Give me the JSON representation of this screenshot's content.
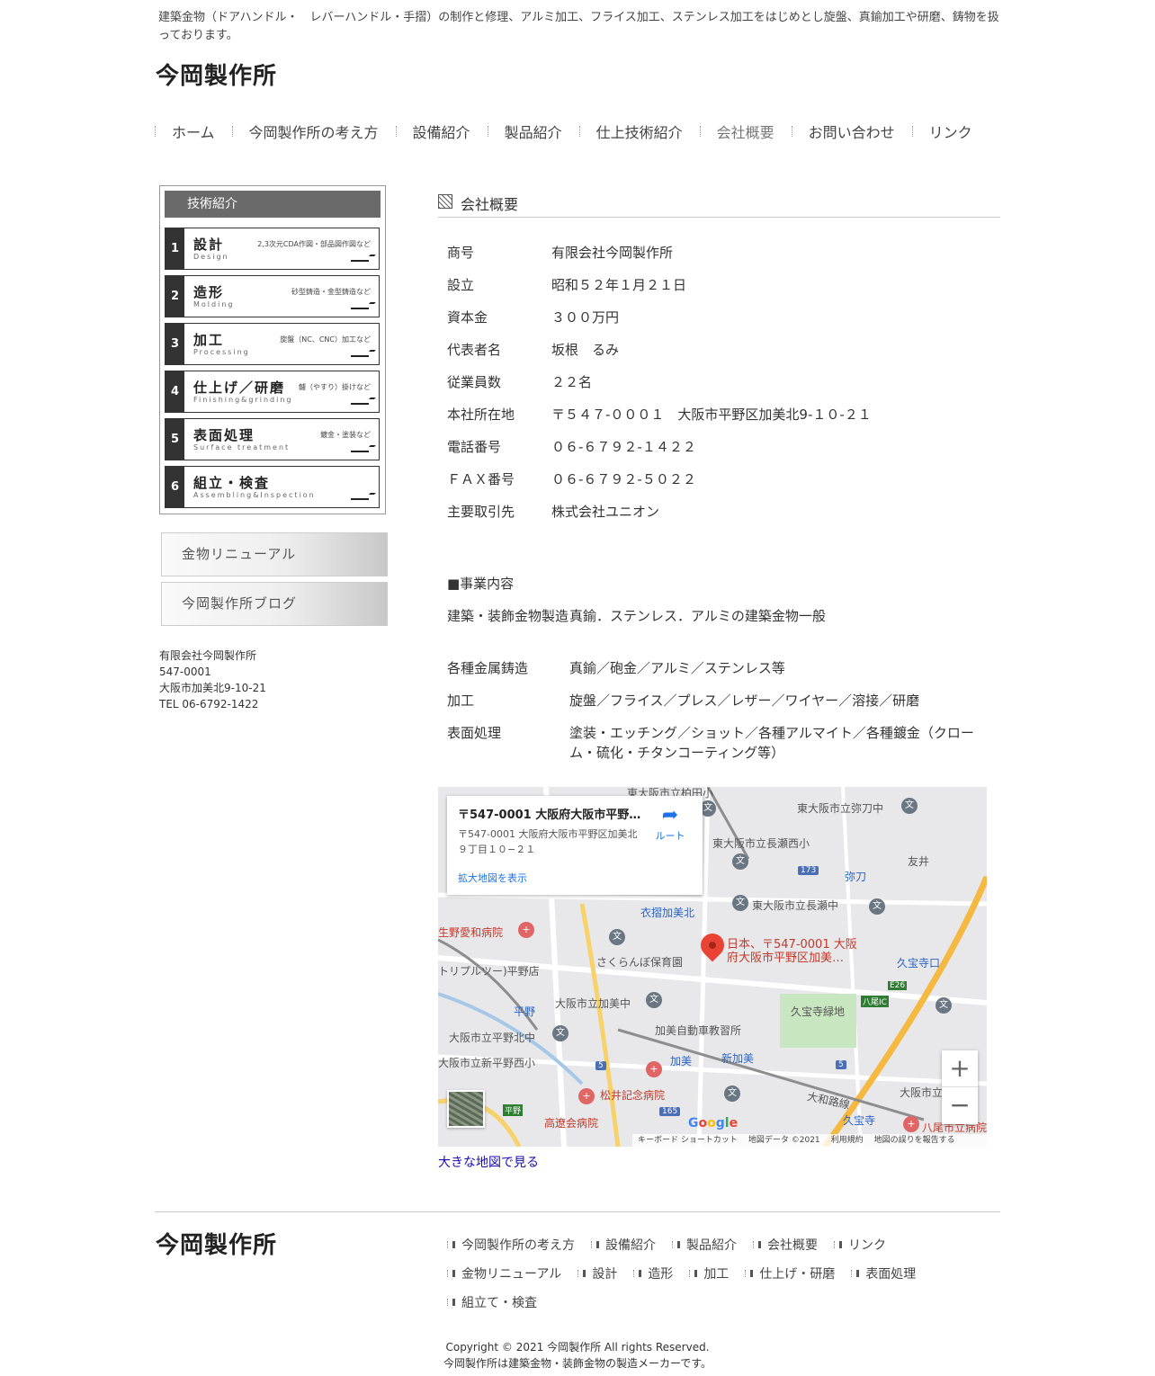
{
  "header": {
    "tagline": "建築金物（ドアハンドル・　レバーハンドル・手摺）の制作と修理、アルミ加工、フライス加工、ステンレス加工をはじめとし旋盤、真鍮加工や研磨、鋳物を扱っております。",
    "site_title": "今岡製作所"
  },
  "nav": {
    "items": [
      {
        "label": "ホーム"
      },
      {
        "label": "今岡製作所の考え方"
      },
      {
        "label": "設備紹介"
      },
      {
        "label": "製品紹介"
      },
      {
        "label": "仕上技術紹介"
      },
      {
        "label": "会社概要"
      },
      {
        "label": "お問い合わせ"
      },
      {
        "label": "リンク"
      }
    ]
  },
  "sidebar": {
    "tech_heading": "技術紹介",
    "tech_items": [
      {
        "num": "1",
        "title": "設計",
        "en": "Design",
        "note": "2,3次元CDA作図・部品図作図など"
      },
      {
        "num": "2",
        "title": "造形",
        "en": "Molding",
        "note": "砂型鋳造・金型鋳造など"
      },
      {
        "num": "3",
        "title": "加工",
        "en": "Processing",
        "note": "旋盤（NC、CNC）加工など"
      },
      {
        "num": "4",
        "title": "仕上げ／研磨",
        "en": "Finishing&grinding",
        "note": "鑢（やすり）掛けなど"
      },
      {
        "num": "5",
        "title": "表面処理",
        "en": "Surface treatment",
        "note": "鍍金・塗装など"
      },
      {
        "num": "6",
        "title": "組立・検査",
        "en": "Assembling&Inspection",
        "note": ""
      }
    ],
    "banners": [
      {
        "label": "金物リニューアル"
      },
      {
        "label": "今岡製作所ブログ"
      }
    ],
    "address": {
      "company": "有限会社今岡製作所",
      "zip": "547-0001",
      "addr": "大阪市加美北9-10-21",
      "tel": "TEL 06-6792-1422"
    }
  },
  "main": {
    "section_title": "会社概要",
    "profile": [
      {
        "k": "商号",
        "v": "有限会社今岡製作所"
      },
      {
        "k": "設立",
        "v": "昭和５２年１月２１日"
      },
      {
        "k": "資本金",
        "v": "３００万円"
      },
      {
        "k": "代表者名",
        "v": "坂根　るみ"
      },
      {
        "k": "従業員数",
        "v": "２２名"
      },
      {
        "k": "本社所在地",
        "v": "〒５４７-０００１　大阪市平野区加美北9-１０-２１"
      },
      {
        "k": "電話番号",
        "v": "０６-６７９２-１４２２"
      },
      {
        "k": "ＦＡＸ番号",
        "v": "０６-６７９２-５０２２"
      },
      {
        "k": "主要取引先",
        "v": "株式会社ユニオン"
      }
    ],
    "business_heading": "■事業内容",
    "business": [
      {
        "k": "建築・装飾金物製造",
        "v": "真鍮．ステンレス．アルミの建築金物一般"
      },
      {
        "k": "各種金属鋳造",
        "v": "真鍮／砲金／アルミ／ステンレス等"
      },
      {
        "k": "加工",
        "v": "旋盤／フライス／プレス／レザー／ワイヤー／溶接／研磨"
      },
      {
        "k": "表面処理",
        "v": "塗装・エッチング／ショット／各種アルマイト／各種鍍金（クローム・硫化・チタンコーティング等）"
      }
    ],
    "map": {
      "info_title": "〒547-0001 大阪府大阪市平野…",
      "info_address": "〒547-0001 大阪府大阪市平野区加美北９丁目１０−２１",
      "info_link": "拡大地図を表示",
      "route_label": "ルート",
      "marker_label": "日本、〒547-0001 大阪府大阪市平野区加美…",
      "labels": {
        "l1": "東大阪市立弥刀中",
        "l2": "東大阪市立柏田小",
        "l3": "東大阪市立長瀬西小",
        "l4": "弥刀",
        "l5": "友井",
        "l6": "東大阪市立長瀬中",
        "l7": "衣摺加美北",
        "l8": "生野愛和病院",
        "l9": "さくらんぼ保育園",
        "l10": "トリプルツー)平野店",
        "l11": "久宝寺口",
        "l12": "八尾IC",
        "l13": "久宝寺緑地",
        "l14": "大阪市立加美中",
        "l15": "平野",
        "l16": "加美自動車教習所",
        "l17": "大阪市立平野北中",
        "l18": "加美",
        "l19": "新加美",
        "l20": "大阪市立新平野西小",
        "l21": "松井記念病院",
        "l22": "大和路線",
        "l23": "大阪市立",
        "l24": "高遼会病院",
        "l25": "久宝寺",
        "l26": "八尾市立病院",
        "l27": "東大阪市立弥刀中"
      },
      "shields": {
        "s173": "173",
        "s26": "E26",
        "s5a": "5",
        "s5b": "5",
        "s165": "165",
        "sHirano": "平野"
      },
      "attribution": [
        "キーボード ショートカット",
        "地図データ ©2021",
        "利用規約",
        "地図の誤りを報告する"
      ],
      "google": "Google"
    },
    "map_link": "大きな地図で見る"
  },
  "footer": {
    "title": "今岡製作所",
    "links": [
      {
        "label": "今岡製作所の考え方"
      },
      {
        "label": "設備紹介"
      },
      {
        "label": "製品紹介"
      },
      {
        "label": "会社概要"
      },
      {
        "label": "リンク"
      },
      {
        "label": "金物リニューアル"
      },
      {
        "label": "設計"
      },
      {
        "label": "造形"
      },
      {
        "label": "加工"
      },
      {
        "label": "仕上げ・研磨"
      },
      {
        "label": "表面処理"
      },
      {
        "label": "組立て・検査"
      }
    ],
    "copyright": "Copyright © 2021 今岡製作所 All rights Reserved.",
    "tagline": "今岡製作所は建築金物・装飾金物の製造メーカーです。"
  }
}
